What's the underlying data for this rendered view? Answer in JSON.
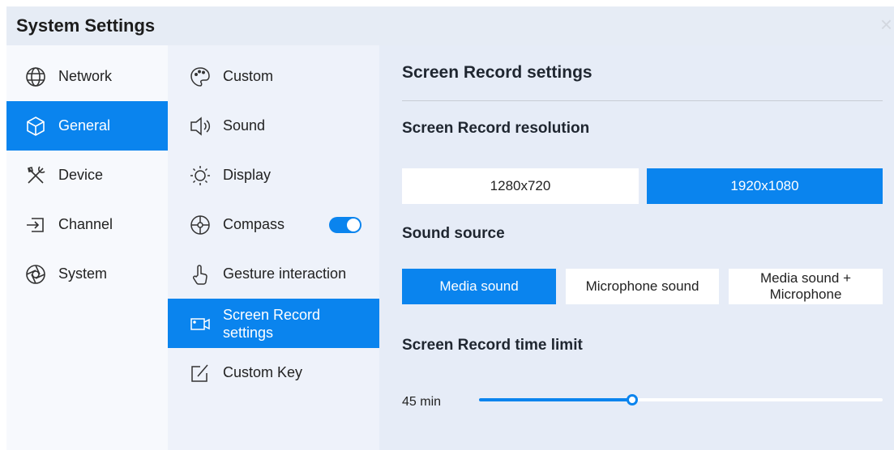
{
  "window": {
    "title": "System Settings",
    "close_glyph": "×"
  },
  "nav": {
    "items": [
      {
        "label": "Network",
        "icon": "globe-icon"
      },
      {
        "label": "General",
        "icon": "cube-icon",
        "active": true
      },
      {
        "label": "Device",
        "icon": "tools-icon"
      },
      {
        "label": "Channel",
        "icon": "input-icon"
      },
      {
        "label": "System",
        "icon": "aperture-icon"
      }
    ]
  },
  "subnav": {
    "items": [
      {
        "label": "Custom",
        "icon": "palette-icon"
      },
      {
        "label": "Sound",
        "icon": "speaker-icon"
      },
      {
        "label": "Display",
        "icon": "sun-icon"
      },
      {
        "label": "Compass",
        "icon": "compass-icon",
        "toggle_on": true
      },
      {
        "label": "Gesture interaction",
        "icon": "hand-icon"
      },
      {
        "label_line1": "Screen Record",
        "label_line2": "settings",
        "icon": "video-camera-icon",
        "active": true
      },
      {
        "label": "Custom Key",
        "icon": "edit-square-icon"
      }
    ]
  },
  "panel": {
    "title": "Screen Record settings",
    "resolution": {
      "label": "Screen Record resolution",
      "options": [
        "1280x720",
        "1920x1080"
      ],
      "selected": "1920x1080"
    },
    "sound_source": {
      "label": "Sound source",
      "options": [
        "Media sound",
        "Microphone sound",
        "Media sound + Microphone"
      ],
      "selected": "Media sound"
    },
    "time_limit": {
      "label": "Screen Record time limit",
      "value_text": "45 min",
      "fraction": 0.38
    }
  },
  "colors": {
    "accent": "#0a84ee",
    "panel_bg": "#e6ecf7",
    "title_bar": "#e6ecf5"
  }
}
